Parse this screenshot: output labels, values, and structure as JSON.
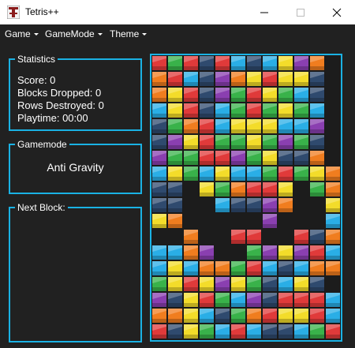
{
  "window": {
    "title": "Tetris++",
    "app_icon": "tetris-t-icon",
    "controls": [
      "minimize-icon",
      "maximize-icon",
      "close-icon"
    ]
  },
  "menu": {
    "items": [
      {
        "label": "Game"
      },
      {
        "label": "GameMode"
      },
      {
        "label": "Theme"
      }
    ]
  },
  "statistics": {
    "title": "Statistics",
    "score": "Score: 0",
    "blocks_dropped": "Blocks Dropped: 0",
    "rows_destroyed": "Rows Destroyed: 0",
    "playtime": "Playtime: 00:00"
  },
  "gamemode": {
    "title": "Gamemode",
    "value": "Anti Gravity"
  },
  "next_block": {
    "title": "Next Block:"
  },
  "board": {
    "columns": 12,
    "rows": 18,
    "palette": {
      "R": "#e03a3a",
      "O": "#f07d1f",
      "Y": "#f3dc2a",
      "G": "#39b24a",
      "B": "#2aaee6",
      "P": "#8a3fb0",
      "N": "#2f4a6e",
      "M": "#c23a9a"
    },
    "grid": [
      "RGRNRBNBYPO.",
      "ORBNPOYRYYN.",
      "OYRNPGRYGBN.",
      "BYRNBGRGYGB.",
      "NGORBYYYBBP.",
      "NPYRGGYGPGN.",
      "PGGRRPGYNNO.",
      "BYGBYBBGRGYO",
      "NN.YGORRY.GO",
      "NN..BNNPO..Y",
      "YO.....P...B",
      "..O..RR..RNO",
      "BBOP..GPYPRB",
      "BYBOOGRBNBOO",
      "GYRYPYGNBYN.",
      "PNYRGBPNRRRB",
      "OOYBNGORYYRB",
      "RNYGBRBNNBGR"
    ]
  }
}
